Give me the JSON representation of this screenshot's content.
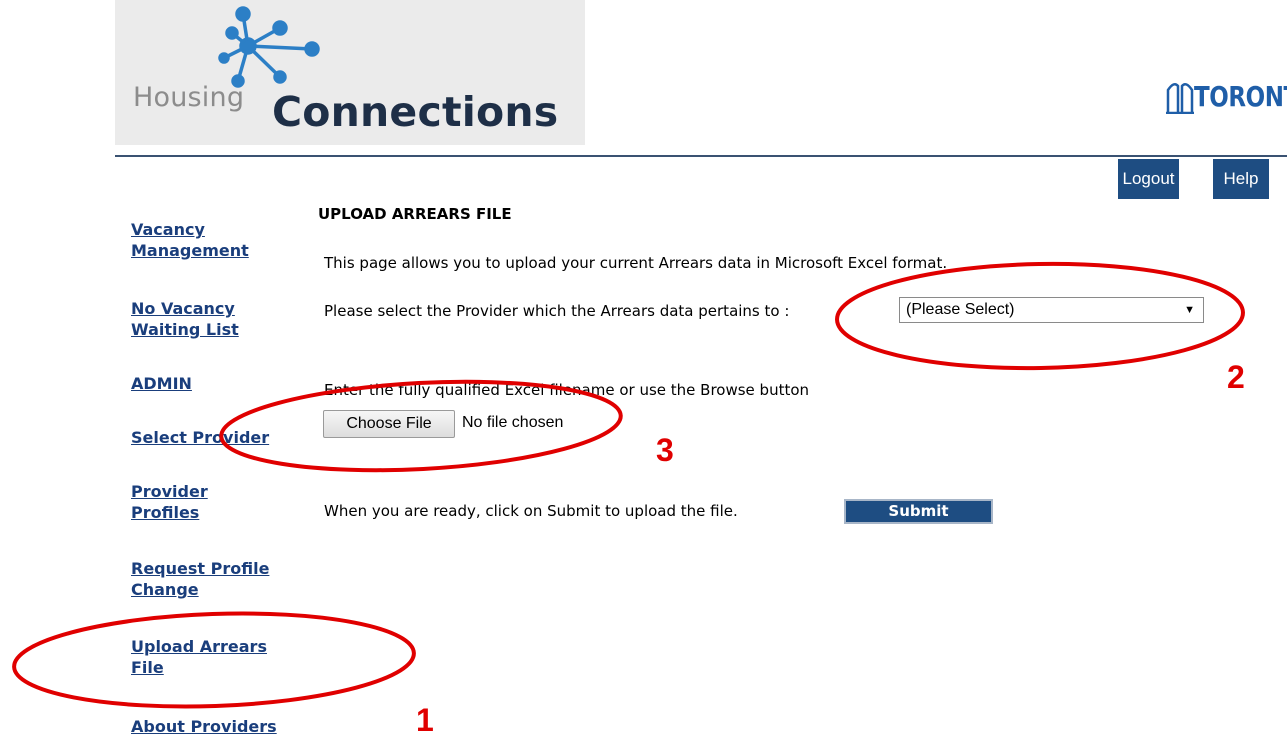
{
  "header": {
    "logo_housing": "Housing",
    "logo_connections": "Connections",
    "city_logo": "TORONTO"
  },
  "top_buttons": {
    "logout": "Logout",
    "help": "Help"
  },
  "sidebar": {
    "items": [
      {
        "line1": "Vacancy",
        "line2": "Management"
      },
      {
        "line1": "No Vacancy",
        "line2": "Waiting List"
      },
      {
        "line1": "ADMIN",
        "line2": ""
      },
      {
        "line1": "Select Provider",
        "line2": ""
      },
      {
        "line1": "Provider",
        "line2": "Profiles"
      },
      {
        "line1": "Request Profile",
        "line2": "Change"
      },
      {
        "line1": "Upload Arrears",
        "line2": "File"
      },
      {
        "line1": "About Providers",
        "line2": ""
      }
    ]
  },
  "main": {
    "title": "UPLOAD ARREARS FILE",
    "intro": "This page allows you to upload your current Arrears data in Microsoft Excel format.",
    "provider_prompt": "Please select the Provider which the Arrears data pertains to :",
    "provider_select": "(Please Select)",
    "file_prompt": "Enter the fully qualified Excel filename or use the Browse button",
    "choose_file": "Choose File",
    "file_status": "No file chosen",
    "submit_prompt": "When you are ready, click on Submit to upload the file.",
    "submit": "Submit"
  },
  "annotations": {
    "marker_1": "1",
    "marker_2": "2",
    "marker_3": "3",
    "color": "#e00000"
  }
}
